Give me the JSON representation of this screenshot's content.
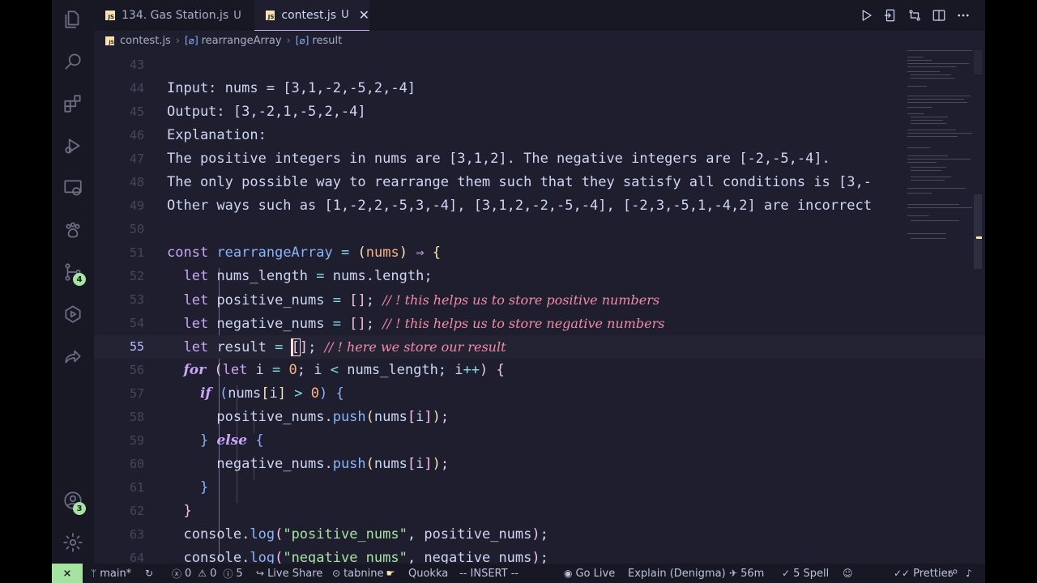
{
  "tabs": [
    {
      "label": "134. Gas Station.js",
      "modified": "U",
      "active": false
    },
    {
      "label": "contest.js",
      "modified": "U",
      "active": true
    }
  ],
  "tab_close": "✕",
  "breadcrumb": {
    "file": "contest.js",
    "fn": "rearrangeArray",
    "var": "result"
  },
  "activity_badges": {
    "scm": "4",
    "accounts": "3"
  },
  "lines": [
    {
      "n": "43"
    },
    {
      "n": "44"
    },
    {
      "n": "45"
    },
    {
      "n": "46"
    },
    {
      "n": "47"
    },
    {
      "n": "48"
    },
    {
      "n": "49"
    },
    {
      "n": "50"
    },
    {
      "n": "51"
    },
    {
      "n": "52"
    },
    {
      "n": "53"
    },
    {
      "n": "54"
    },
    {
      "n": "55"
    },
    {
      "n": "56"
    },
    {
      "n": "57"
    },
    {
      "n": "58"
    },
    {
      "n": "59"
    },
    {
      "n": "60"
    },
    {
      "n": "61"
    },
    {
      "n": "62"
    },
    {
      "n": "63"
    },
    {
      "n": "64"
    }
  ],
  "code": {
    "l44": "Input: nums = [3,1,-2,-5,2,-4]",
    "l45": "Output: [3,-2,1,-5,2,-4]",
    "l46": "Explanation:",
    "l47": "The positive integers in nums are [3,1,2]. The negative integers are [-2,-5,-4].",
    "l48": "The only possible way to rearrange them such that they satisfy all conditions is [3,-",
    "l49": "Other ways such as [1,-2,2,-5,3,-4], [3,1,2,-2,-5,-4], [-2,3,-5,1,-4,2] are incorrect",
    "c53": "// ! this helps us to store positive numbers",
    "c54": "// ! this helps us to store negative numbers",
    "c55": "// ! here we store our result",
    "s63": "\"positive_nums\"",
    "s64": "\"negative_nums\""
  },
  "status": {
    "branch": "main*",
    "errors": "0",
    "warnings": "0",
    "info": "5",
    "live_share": "Live Share",
    "tabnine": "tabnine",
    "quokka": "Quokka",
    "mode": "-- INSERT --",
    "go_live": "Go Live",
    "explain": "Explain (Denigma)",
    "time": "56m",
    "spell": "5 Spell",
    "prettier": "Prettier"
  },
  "colors": {
    "background": "#1e1e2e",
    "keyword": "#cba6f7",
    "function": "#89b4fa",
    "string": "#a6e3a1",
    "number": "#fab387",
    "comment": "#f38ba8",
    "accent": "#a6e3a1"
  }
}
